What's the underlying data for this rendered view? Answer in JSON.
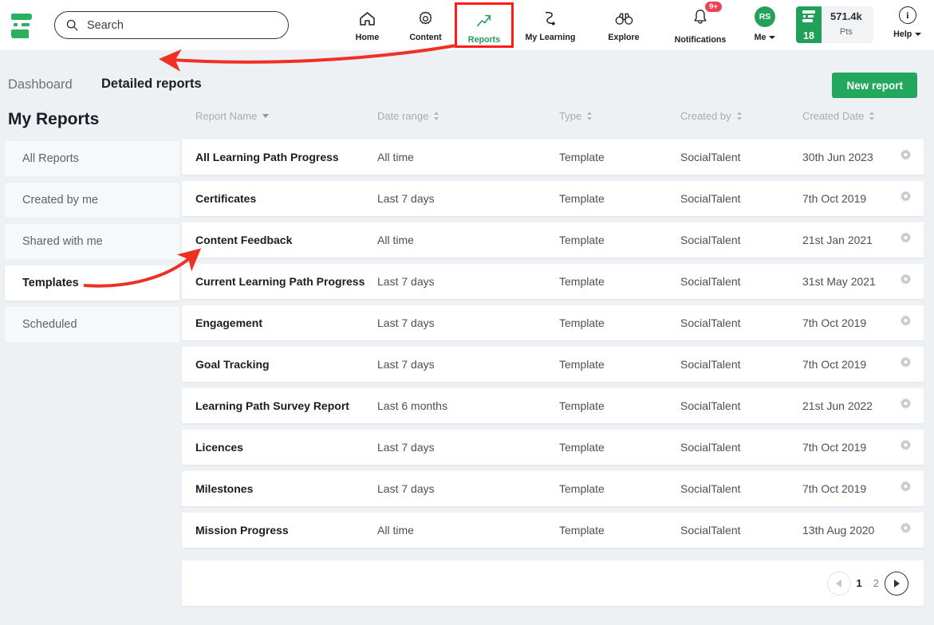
{
  "topbar": {
    "logo_name": "socialtalent-logo",
    "search": {
      "placeholder": "Search",
      "value": ""
    },
    "nav": [
      {
        "label": "Home",
        "icon": "home-icon",
        "active": false
      },
      {
        "label": "Content",
        "icon": "gear-icon",
        "active": false
      },
      {
        "label": "Reports",
        "icon": "trending-up-icon",
        "active": true
      },
      {
        "label": "My Learning",
        "icon": "path-icon",
        "active": false
      },
      {
        "label": "Explore",
        "icon": "binoculars-icon",
        "active": false
      }
    ],
    "notifications": {
      "label": "Notifications",
      "badge": "9+",
      "icon": "bell-icon"
    },
    "me": {
      "label": "Me",
      "initials": "RS"
    },
    "points": {
      "level": "18",
      "amount": "571.4k",
      "unit": "Pts"
    },
    "help": {
      "label": "Help",
      "icon": "info-icon"
    }
  },
  "breadcrumb": {
    "parent": "Dashboard",
    "current": "Detailed reports"
  },
  "actions": {
    "new_report": "New report"
  },
  "sidebar": {
    "title": "My Reports",
    "items": [
      {
        "label": "All Reports",
        "active": false
      },
      {
        "label": "Created by me",
        "active": false
      },
      {
        "label": "Shared with me",
        "active": false
      },
      {
        "label": "Templates",
        "active": true
      },
      {
        "label": "Scheduled",
        "active": false
      }
    ]
  },
  "table": {
    "columns": [
      {
        "label": "Report Name",
        "sort": "desc"
      },
      {
        "label": "Date range",
        "sort": "none"
      },
      {
        "label": "Type",
        "sort": "none"
      },
      {
        "label": "Created by",
        "sort": "none"
      },
      {
        "label": "Created Date",
        "sort": "none"
      }
    ],
    "row_action_icon": "gear-icon",
    "rows": [
      {
        "name": "All Learning Path Progress",
        "range": "All time",
        "type": "Template",
        "creator": "SocialTalent",
        "created": "30th Jun 2023"
      },
      {
        "name": "Certificates",
        "range": "Last 7 days",
        "type": "Template",
        "creator": "SocialTalent",
        "created": "7th Oct 2019"
      },
      {
        "name": "Content Feedback",
        "range": "All time",
        "type": "Template",
        "creator": "SocialTalent",
        "created": "21st Jan 2021"
      },
      {
        "name": "Current Learning Path Progress",
        "range": "Last 7 days",
        "type": "Template",
        "creator": "SocialTalent",
        "created": "31st May 2021"
      },
      {
        "name": "Engagement",
        "range": "Last 7 days",
        "type": "Template",
        "creator": "SocialTalent",
        "created": "7th Oct 2019"
      },
      {
        "name": "Goal Tracking",
        "range": "Last 7 days",
        "type": "Template",
        "creator": "SocialTalent",
        "created": "7th Oct 2019"
      },
      {
        "name": "Learning Path Survey Report",
        "range": "Last 6 months",
        "type": "Template",
        "creator": "SocialTalent",
        "created": "21st Jun 2022"
      },
      {
        "name": "Licences",
        "range": "Last 7 days",
        "type": "Template",
        "creator": "SocialTalent",
        "created": "7th Oct 2019"
      },
      {
        "name": "Milestones",
        "range": "Last 7 days",
        "type": "Template",
        "creator": "SocialTalent",
        "created": "7th Oct 2019"
      },
      {
        "name": "Mission Progress",
        "range": "All time",
        "type": "Template",
        "creator": "SocialTalent",
        "created": "13th Aug 2020"
      }
    ]
  },
  "pagination": {
    "pages": [
      "1",
      "2"
    ],
    "current": "1",
    "prev_icon": "chevron-left-icon",
    "next_icon": "chevron-right-icon"
  },
  "annotations": {
    "highlight_color": "#ff1d15",
    "arrow_color": "#ef3124",
    "items": [
      {
        "name": "arrow-to-reports-tab"
      },
      {
        "name": "arrow-to-templates"
      },
      {
        "name": "highlight-box-reports-tab"
      }
    ]
  },
  "colors": {
    "brand_green": "#22a85c",
    "page_bg": "#eef1f4",
    "accent_red": "#ff1d15"
  }
}
